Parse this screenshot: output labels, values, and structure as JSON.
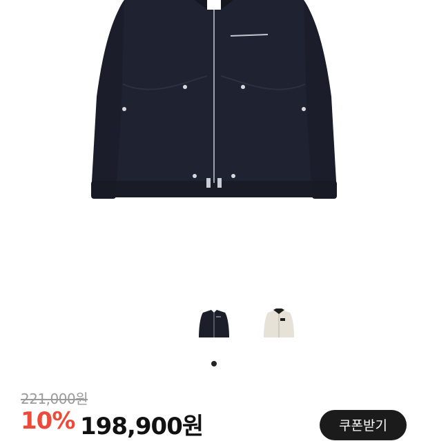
{
  "product": {
    "main_image_icon": "jacket-black-image",
    "thumbnails": [
      {
        "icon": "jacket-black-thumbnail",
        "color": "#1c1f2a"
      },
      {
        "icon": "jacket-cream-thumbnail",
        "color": "#e7e2d8"
      }
    ],
    "gallery_index": 1
  },
  "pricing": {
    "original_price": "221,000원",
    "discount_rate": "10%",
    "sale_price": "198,900원",
    "coupon_label": "쿠폰받기"
  },
  "colors": {
    "discount": "#ec4b3b",
    "button_bg": "#1b1b1b"
  }
}
